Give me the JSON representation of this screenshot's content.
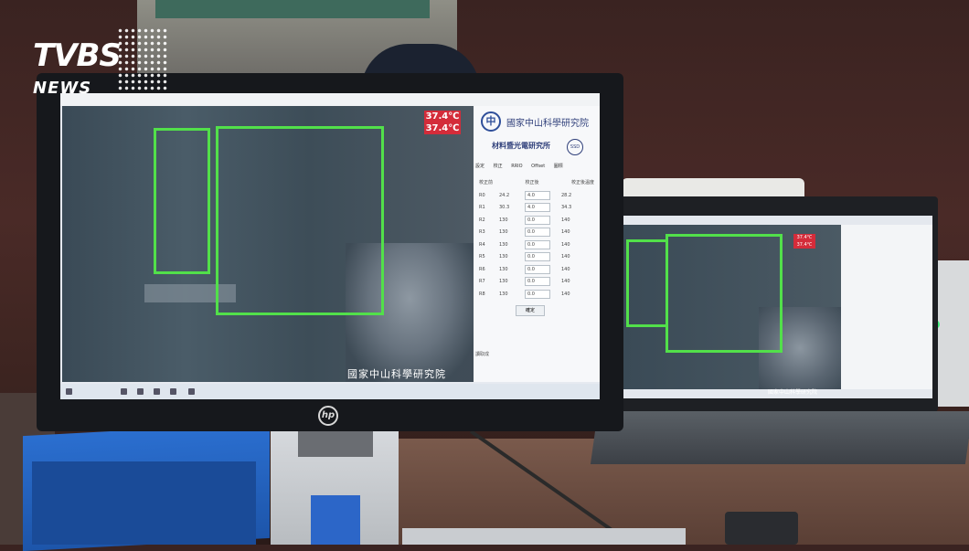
{
  "watermark": {
    "brand": "TVBS",
    "sub": "NEWS"
  },
  "main_screen": {
    "temperature_readings": [
      "37.4℃",
      "37.4℃"
    ],
    "caption": "國家中山科學研究院",
    "panel": {
      "org_logo": "中",
      "org_name": "國家中山科學研究院",
      "dept_name": "材料暨光電研究所",
      "dept_badge": "SSD",
      "tabs": [
        "設定",
        "校正",
        "RRIO",
        "Offset",
        "圖標"
      ],
      "columns": [
        "校正前",
        "校正後",
        "校正後溫度"
      ],
      "rows": [
        {
          "label": "R0",
          "before": "24.2",
          "input": "4.0",
          "after": "28.2"
        },
        {
          "label": "R1",
          "before": "30.3",
          "input": "4.0",
          "after": "34.3"
        },
        {
          "label": "R2",
          "before": "130",
          "input": "0.0",
          "after": "140"
        },
        {
          "label": "R3",
          "before": "130",
          "input": "0.0",
          "after": "140"
        },
        {
          "label": "R4",
          "before": "130",
          "input": "0.0",
          "after": "140"
        },
        {
          "label": "R5",
          "before": "130",
          "input": "0.0",
          "after": "140"
        },
        {
          "label": "R6",
          "before": "130",
          "input": "0.0",
          "after": "140"
        },
        {
          "label": "R7",
          "before": "130",
          "input": "0.0",
          "after": "140"
        },
        {
          "label": "R8",
          "before": "130",
          "input": "0.0",
          "after": "140"
        }
      ],
      "confirm_label": "確定",
      "status": "讀取成"
    }
  },
  "laptop_screen": {
    "temperature_readings": [
      "37.4℃",
      "37.4℃"
    ],
    "caption": "國家中山科學研究院"
  },
  "monitor_brand": "hp",
  "colors": {
    "detection_box": "#52e04a",
    "temp_tag": "#d42c3a",
    "binder": "#2b6fd0"
  }
}
